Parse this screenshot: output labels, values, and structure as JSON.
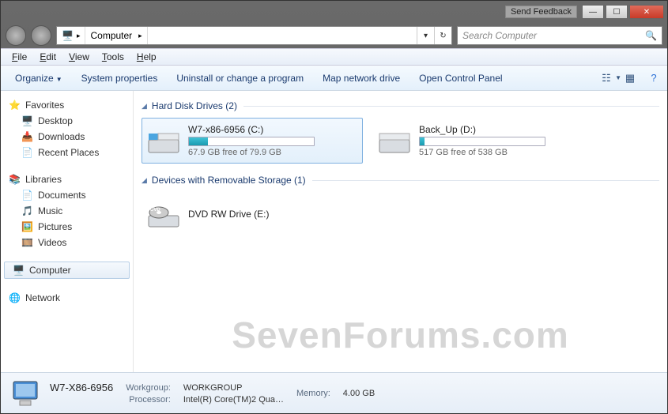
{
  "titlebar": {
    "feedback": "Send Feedback"
  },
  "address": {
    "location": "Computer"
  },
  "search": {
    "placeholder": "Search Computer"
  },
  "menubar": [
    "File",
    "Edit",
    "View",
    "Tools",
    "Help"
  ],
  "toolbar": {
    "organize": "Organize",
    "sysprops": "System properties",
    "uninstall": "Uninstall or change a program",
    "mapdrive": "Map network drive",
    "controlpanel": "Open Control Panel"
  },
  "sidebar": {
    "favorites": {
      "label": "Favorites",
      "items": [
        "Desktop",
        "Downloads",
        "Recent Places"
      ]
    },
    "libraries": {
      "label": "Libraries",
      "items": [
        "Documents",
        "Music",
        "Pictures",
        "Videos"
      ]
    },
    "computer": {
      "label": "Computer"
    },
    "network": {
      "label": "Network"
    }
  },
  "sections": {
    "hdd": {
      "label": "Hard Disk Drives (2)"
    },
    "removable": {
      "label": "Devices with Removable Storage (1)"
    }
  },
  "drives": {
    "c": {
      "name": "W7-x86-6956 (C:)",
      "free": "67.9 GB free of 79.9 GB",
      "fill_pct": 15
    },
    "d": {
      "name": "Back_Up (D:)",
      "free": "517 GB free of 538 GB",
      "fill_pct": 4
    },
    "e": {
      "name": "DVD RW Drive (E:)"
    }
  },
  "details": {
    "name": "W7-X86-6956",
    "workgroup_label": "Workgroup:",
    "workgroup_value": "WORKGROUP",
    "memory_label": "Memory:",
    "memory_value": "4.00 GB",
    "processor_label": "Processor:",
    "processor_value": "Intel(R) Core(TM)2 Qua…"
  },
  "watermark": "SevenForums.com"
}
